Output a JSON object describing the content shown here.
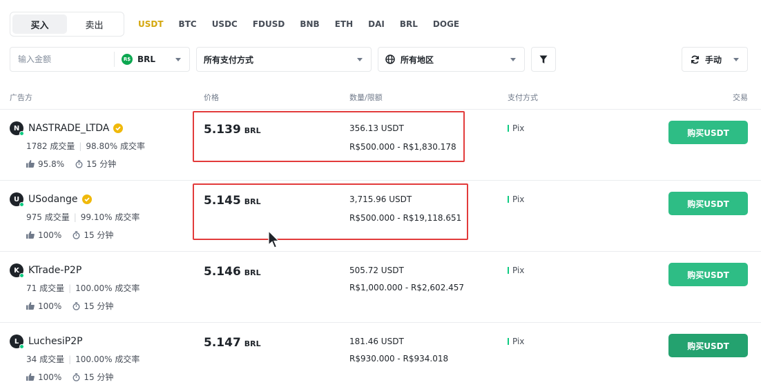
{
  "side": {
    "buy": "买入",
    "sell": "卖出"
  },
  "coins": [
    "USDT",
    "BTC",
    "USDC",
    "FDUSD",
    "BNB",
    "ETH",
    "DAI",
    "BRL",
    "DOGE"
  ],
  "filters": {
    "amount_placeholder": "输入金额",
    "fiat_symbol": "R$",
    "fiat": "BRL",
    "payment": "所有支付方式",
    "region": "所有地区",
    "refresh": "手动"
  },
  "headers": {
    "advertiser": "广告方",
    "price": "价格",
    "amount": "数量/限额",
    "payment": "支付方式",
    "trade": "交易"
  },
  "ads": [
    {
      "initial": "N",
      "name": "NASTRADE_LTDA",
      "verified": true,
      "orders": "1782 成交量",
      "completion": "98.80% 成交率",
      "rating": "95.8%",
      "time": "15 分钟",
      "price": "5.139",
      "unit": "BRL",
      "qty": "356.13 USDT",
      "limit": "R$500.000 - R$1,830.178",
      "pay": "Pix",
      "button": "购买USDT"
    },
    {
      "initial": "U",
      "name": "USodange",
      "verified": true,
      "orders": "975 成交量",
      "completion": "99.10% 成交率",
      "rating": "100%",
      "time": "15 分钟",
      "price": "5.145",
      "unit": "BRL",
      "qty": "3,715.96 USDT",
      "limit": "R$500.000 - R$19,118.651",
      "pay": "Pix",
      "button": "购买USDT"
    },
    {
      "initial": "K",
      "name": "KTrade-P2P",
      "verified": false,
      "orders": "71 成交量",
      "completion": "100.00% 成交率",
      "rating": "100%",
      "time": "15 分钟",
      "price": "5.146",
      "unit": "BRL",
      "qty": "505.72 USDT",
      "limit": "R$1,000.000 - R$2,602.457",
      "pay": "Pix",
      "button": "购买USDT"
    },
    {
      "initial": "L",
      "name": "LuchesiP2P",
      "verified": false,
      "orders": "34 成交量",
      "completion": "100.00% 成交率",
      "rating": "100%",
      "time": "15 分钟",
      "price": "5.147",
      "unit": "BRL",
      "qty": "181.46 USDT",
      "limit": "R$930.000 - R$934.018",
      "pay": "Pix",
      "button": "购买USDT"
    }
  ],
  "colors": {
    "accent": "#d4a70e",
    "buy": "#2ebd85",
    "highlight": "#e23a3a"
  }
}
